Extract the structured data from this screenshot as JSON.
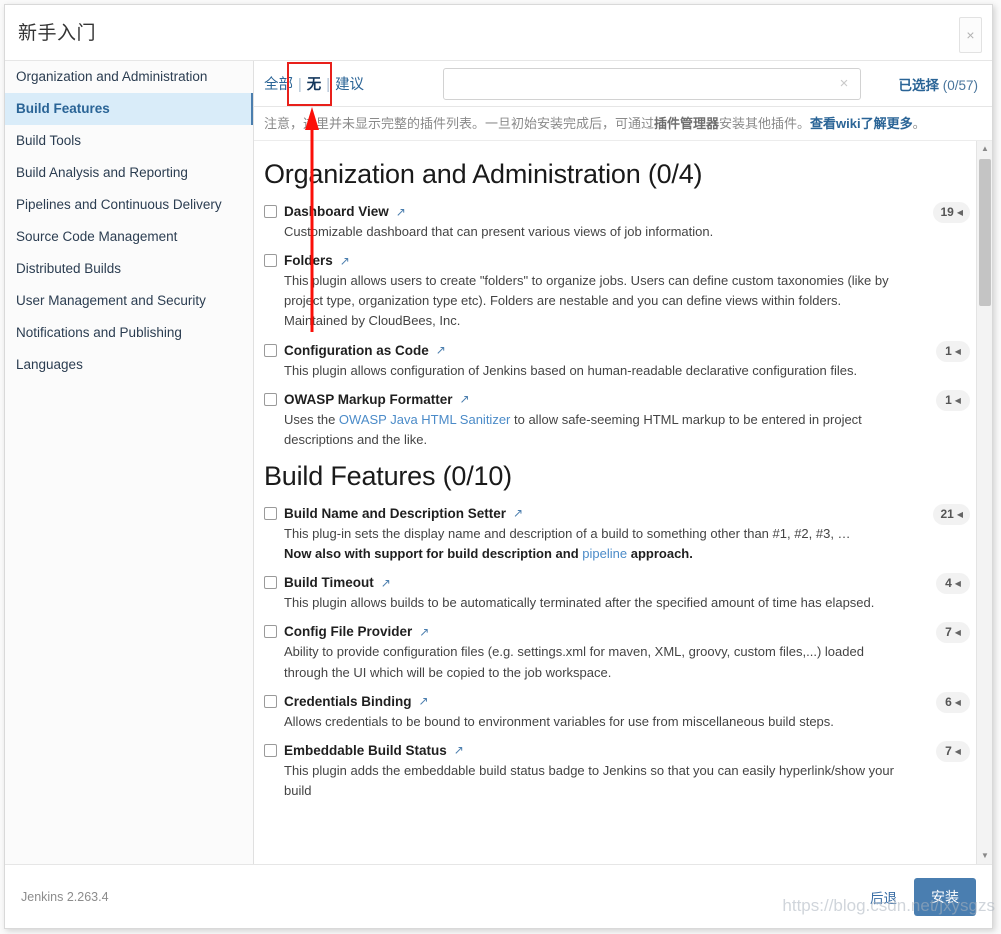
{
  "window": {
    "title": "新手入门",
    "close_label": "×"
  },
  "sidebar": {
    "items": [
      {
        "label": "Organization and Administration",
        "active": false
      },
      {
        "label": "Build Features",
        "active": true
      },
      {
        "label": "Build Tools",
        "active": false
      },
      {
        "label": "Build Analysis and Reporting",
        "active": false
      },
      {
        "label": "Pipelines and Continuous Delivery",
        "active": false
      },
      {
        "label": "Source Code Management",
        "active": false
      },
      {
        "label": "Distributed Builds",
        "active": false
      },
      {
        "label": "User Management and Security",
        "active": false
      },
      {
        "label": "Notifications and Publishing",
        "active": false
      },
      {
        "label": "Languages",
        "active": false
      }
    ]
  },
  "filterbar": {
    "tab_all": "全部",
    "tab_none": "无",
    "tab_suggested": "建议",
    "separator": "|",
    "search_value": "",
    "search_placeholder": "",
    "clear_icon": "×",
    "selected_label": "已选择",
    "selected_count": "(0/57)"
  },
  "notice": {
    "part1": "注意，这里并未显示完整的插件列表。一旦初始安装完成后，可通过",
    "bold": "插件管理器",
    "part2": "安装其他插件。",
    "link": "查看wiki了解更多",
    "part3": "。"
  },
  "sections": [
    {
      "heading": "Organization and Administration (0/4)",
      "plugins": [
        {
          "name": "Dashboard View",
          "badge": "19",
          "desc_parts": [
            {
              "t": "Customizable dashboard that can present various views of job information.",
              "style": "plain"
            }
          ]
        },
        {
          "name": "Folders",
          "badge": "",
          "desc_parts": [
            {
              "t": "This plugin allows users to create \"folders\" to organize jobs. Users can define custom taxonomies (like by project type, organization type etc). Folders are nestable and you can define views within folders. Maintained by CloudBees, Inc.",
              "style": "plain"
            }
          ]
        },
        {
          "name": "Configuration as Code",
          "badge": "1",
          "desc_parts": [
            {
              "t": "This plugin allows configuration of Jenkins based on human-readable declarative configuration files.",
              "style": "plain"
            }
          ]
        },
        {
          "name": "OWASP Markup Formatter",
          "badge": "1",
          "desc_parts": [
            {
              "t": "Uses the ",
              "style": "plain"
            },
            {
              "t": "OWASP Java HTML Sanitizer",
              "style": "link"
            },
            {
              "t": " to allow safe-seeming HTML markup to be entered in project descriptions and the like.",
              "style": "plain"
            }
          ]
        }
      ]
    },
    {
      "heading": "Build Features (0/10)",
      "plugins": [
        {
          "name": "Build Name and Description Setter",
          "badge": "21",
          "desc_parts": [
            {
              "t": "This plug-in sets the display name and description of a build to something other than #1, #2, #3, …",
              "style": "plain"
            },
            {
              "t": "\n",
              "style": "break"
            },
            {
              "t": "Now also with support for build description and ",
              "style": "bold"
            },
            {
              "t": "pipeline",
              "style": "link"
            },
            {
              "t": " approach.",
              "style": "bold"
            }
          ]
        },
        {
          "name": "Build Timeout",
          "badge": "4",
          "desc_parts": [
            {
              "t": "This plugin allows builds to be automatically terminated after the specified amount of time has elapsed.",
              "style": "plain"
            }
          ]
        },
        {
          "name": "Config File Provider",
          "badge": "7",
          "desc_parts": [
            {
              "t": "Ability to provide configuration files (e.g. settings.xml for maven, XML, groovy, custom files,...) loaded through the UI which will be copied to the job workspace.",
              "style": "plain"
            }
          ]
        },
        {
          "name": "Credentials Binding",
          "badge": "6",
          "desc_parts": [
            {
              "t": "Allows credentials to be bound to environment variables for use from miscellaneous build steps.",
              "style": "plain"
            }
          ]
        },
        {
          "name": "Embeddable Build Status",
          "badge": "7",
          "desc_parts": [
            {
              "t": "This plugin adds the embeddable build status badge to Jenkins so that you can easily hyperlink/show your build",
              "style": "plain"
            }
          ]
        }
      ]
    }
  ],
  "scrollbar": {
    "up_arrow": "▲",
    "down_arrow": "▼"
  },
  "footer": {
    "version": "Jenkins 2.263.4",
    "back_label": "后退",
    "install_label": "安装"
  },
  "annotations": {
    "highlight_color": "#e8201b",
    "watermark": "https://blog.csdn.net/jxysgzs"
  }
}
